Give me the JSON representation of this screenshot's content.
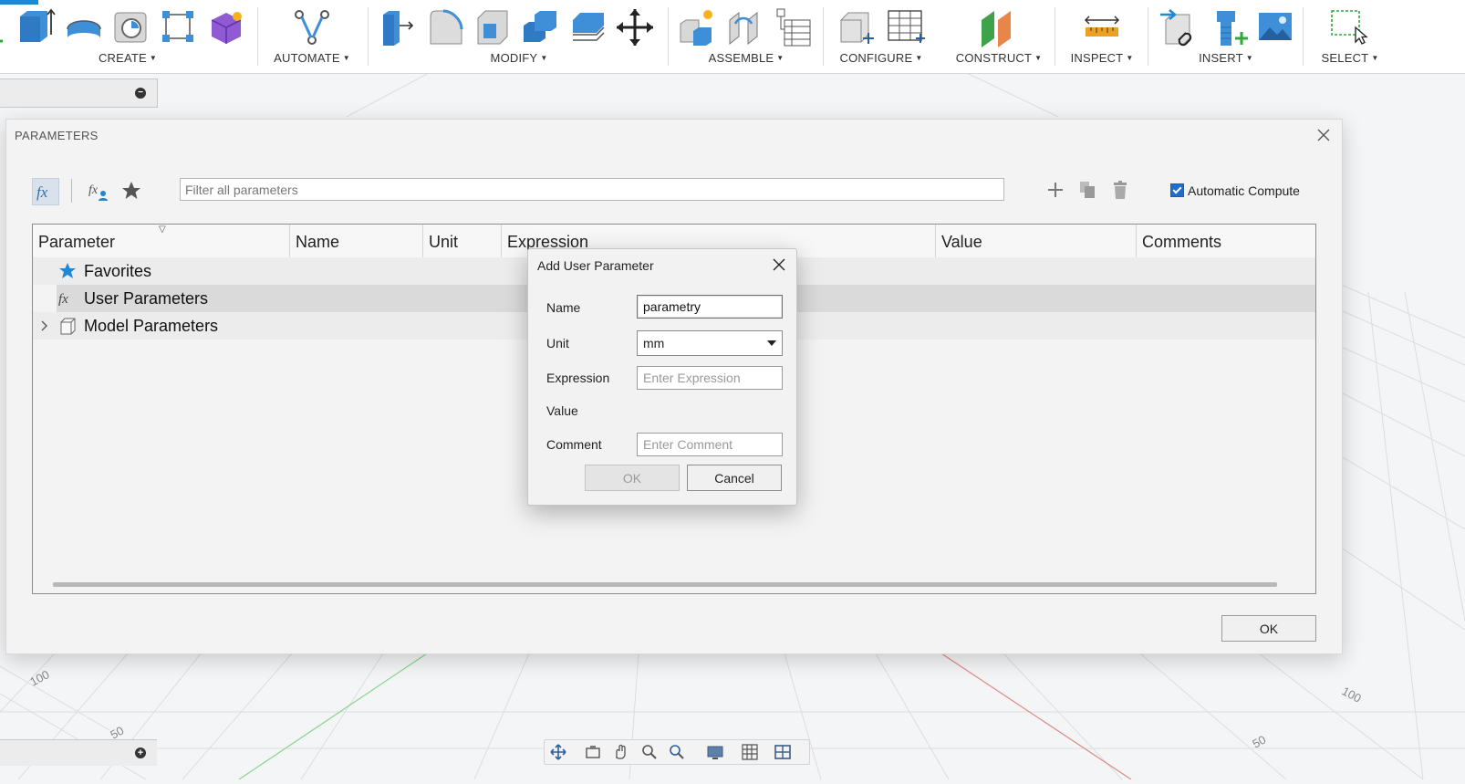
{
  "toolbar": {
    "groups": [
      {
        "label": "CREATE",
        "icons": [
          "sketch-icon",
          "extrude-icon",
          "revolve-icon",
          "hole-icon",
          "pattern-icon",
          "form-icon"
        ]
      },
      {
        "label": "AUTOMATE",
        "icons": [
          "automate-icon"
        ]
      },
      {
        "label": "MODIFY",
        "icons": [
          "press-pull-icon",
          "fillet-icon",
          "shell-icon",
          "combine-icon",
          "offset-face-icon",
          "move-icon"
        ]
      },
      {
        "label": "ASSEMBLE",
        "icons": [
          "new-component-icon",
          "joint-icon",
          "bom-icon"
        ]
      },
      {
        "label": "CONFIGURE",
        "icons": [
          "configure-icon",
          "table-icon"
        ]
      },
      {
        "label": "CONSTRUCT",
        "icons": [
          "plane-icon"
        ]
      },
      {
        "label": "INSPECT",
        "icons": [
          "measure-icon"
        ]
      },
      {
        "label": "INSERT",
        "icons": [
          "insert-derive-icon",
          "insert-mcmaster-icon",
          "canvas-icon"
        ]
      },
      {
        "label": "SELECT",
        "icons": [
          "select-window-icon"
        ]
      }
    ]
  },
  "parameters_dialog": {
    "title": "PARAMETERS",
    "filter_placeholder": "Filter all parameters",
    "auto_compute_label": "Automatic Compute",
    "columns": [
      "Parameter",
      "Name",
      "Unit",
      "Expression",
      "Value",
      "Comments"
    ],
    "rows": [
      {
        "label": "Favorites",
        "icon": "star-icon"
      },
      {
        "label": "User Parameters",
        "icon": "fx-icon",
        "selected": true
      },
      {
        "label": "Model Parameters",
        "icon": "model-icon",
        "expandable": true
      }
    ],
    "ok_label": "OK"
  },
  "add_user_parameter": {
    "title": "Add User Parameter",
    "name_label": "Name",
    "name_value": "parametry",
    "unit_label": "Unit",
    "unit_value": "mm",
    "expression_label": "Expression",
    "expression_placeholder": "Enter Expression",
    "value_label": "Value",
    "comment_label": "Comment",
    "comment_placeholder": "Enter Comment",
    "ok_label": "OK",
    "cancel_label": "Cancel"
  },
  "viewport": {
    "axis_labels": [
      "100",
      "50",
      "100",
      "50"
    ]
  }
}
